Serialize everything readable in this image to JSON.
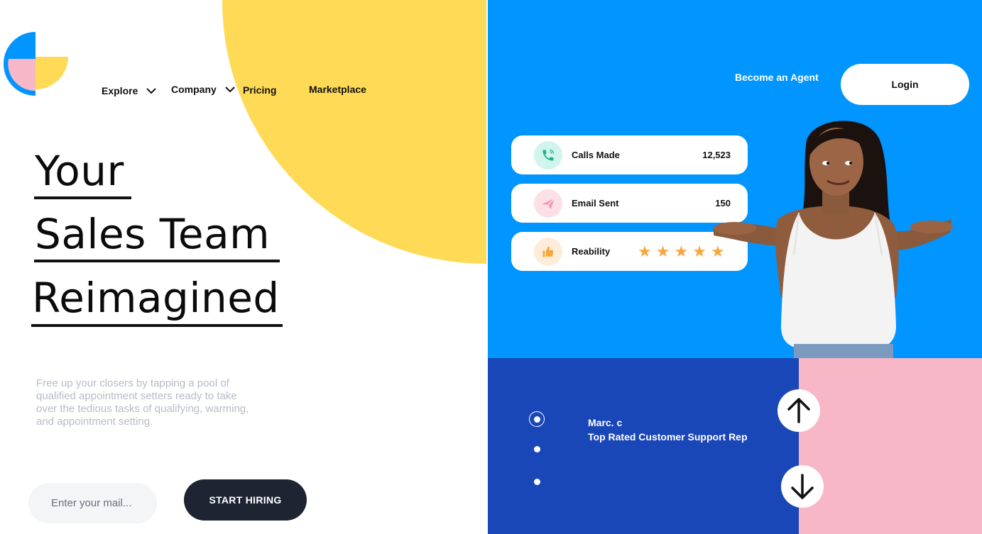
{
  "nav": {
    "explore": "Explore",
    "company": "Company",
    "pricing": "Pricing",
    "marketplace": "Marketplace"
  },
  "hero": {
    "line1": "Your",
    "line2": "Sales Team",
    "line3": "Reimagined",
    "subtext": "Free up your closers by tapping a pool of qualified appointment setters ready to take over the tedious tasks of qualifying, warming, and appointment setting."
  },
  "cta": {
    "email_placeholder": "Enter your mail...",
    "start_label": "START HIRING"
  },
  "header_right": {
    "agent_link": "Become an Agent",
    "login_label": "Login"
  },
  "stats": [
    {
      "label": "Calls Made",
      "value": "12,523",
      "icon": "phone-icon"
    },
    {
      "label": "Email Sent",
      "value": "150",
      "icon": "paper-plane-icon"
    },
    {
      "label": "Reability",
      "rating": 5,
      "icon": "thumbs-up-icon"
    }
  ],
  "testimonial": {
    "name": "Marc. c",
    "title": "Top Rated Customer Support Rep"
  },
  "colors": {
    "yellow": "#FEDA57",
    "blue": "#0095FF",
    "navy": "#1A47B8",
    "pink": "#F8B7C6",
    "dark": "#1E2432",
    "star": "#F7A63C"
  }
}
